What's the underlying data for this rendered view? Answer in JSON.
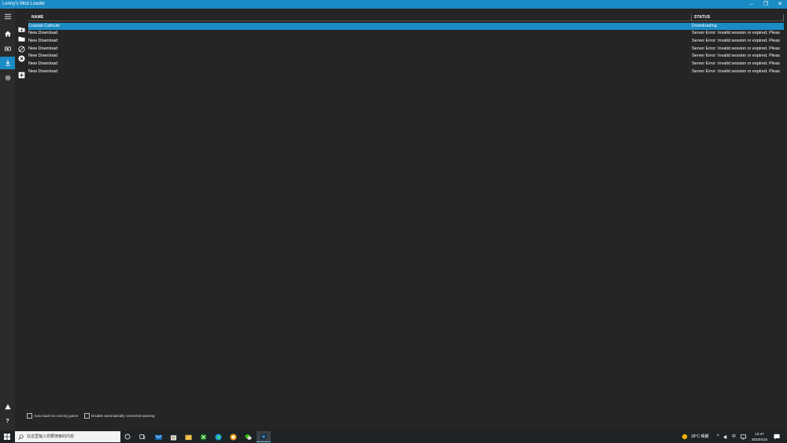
{
  "window": {
    "title": "Lenny's Mod Loader",
    "controls": [
      "–",
      "❐",
      "✕"
    ]
  },
  "sidebar": {
    "items": [
      {
        "icon": "hamburger-menu-icon"
      },
      {
        "icon": "home-icon"
      },
      {
        "icon": "mods-icon"
      },
      {
        "icon": "download-icon",
        "active": true
      },
      {
        "icon": "gear-icon"
      },
      {
        "icon": "warning-icon"
      },
      {
        "icon": "help-icon",
        "label": "?"
      }
    ]
  },
  "table": {
    "columns": [
      "NAME",
      "STATUS"
    ],
    "rows": [
      {
        "name": "Coastal Callouts",
        "status": "Downloading",
        "selected": true
      },
      {
        "name": "New Download",
        "status": "Server Error: Invalid session or expired. Pleas"
      },
      {
        "name": "New Download",
        "status": "Server Error: Invalid session or expired. Pleas"
      },
      {
        "name": "New Download",
        "status": "Server Error: Invalid session or expired. Pleas"
      },
      {
        "name": "New Download",
        "status": "Server Error: Invalid session or expired. Pleas"
      },
      {
        "name": "New Download",
        "status": "Server Error: Invalid session or expired. Pleas"
      },
      {
        "name": "New Download",
        "status": "Server Error: Invalid session or expired. Pleas"
      }
    ]
  },
  "row_actions": [
    {
      "icon": "folder-add-icon"
    },
    {
      "icon": "folder-icon"
    },
    {
      "icon": "cancel-circle-icon"
    },
    {
      "icon": "close-circle-icon"
    },
    {
      "icon": "add-square-icon"
    }
  ],
  "footer": {
    "auto_load_label": "Auto load into running game",
    "auto_load_checked": false,
    "disable_warning_label": "Disable automatically converted warning",
    "disable_warning_checked": false
  },
  "taskbar": {
    "search_placeholder": "在这里输入你要搜索的内容",
    "weather": "18°C  晴朗",
    "ime": "中",
    "time": "12:47",
    "date": "2022/4/15",
    "colors": {
      "accent": "#1a8bc4",
      "background": "#252525",
      "sidebar": "#2b2b2b"
    }
  }
}
